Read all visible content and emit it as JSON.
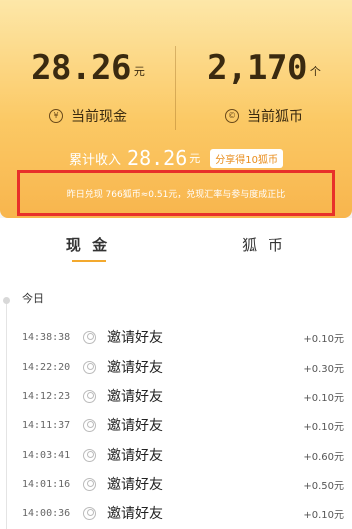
{
  "summary": {
    "cash_value": "28.26",
    "cash_unit": "元",
    "cash_label": "当前现金",
    "cash_icon_glyph": "¥",
    "coins_value": "2,170",
    "coins_unit": "个",
    "coins_label": "当前狐币",
    "coins_icon_glyph": "©",
    "total_label": "累计收入",
    "total_value": "28.26",
    "total_unit": "元",
    "share_button": "分享得10狐币",
    "notice": "昨日兑现 766狐币≈0.51元，兑现汇率与参与度成正比"
  },
  "tabs": [
    {
      "label": "现 金",
      "active": true
    },
    {
      "label": "狐 币",
      "active": false
    }
  ],
  "list": {
    "day_label": "今日",
    "rows": [
      {
        "time": "14:38:38",
        "title": "邀请好友",
        "amount": "+0.10元"
      },
      {
        "time": "14:22:20",
        "title": "邀请好友",
        "amount": "+0.30元"
      },
      {
        "time": "14:12:23",
        "title": "邀请好友",
        "amount": "+0.10元"
      },
      {
        "time": "14:11:37",
        "title": "邀请好友",
        "amount": "+0.10元"
      },
      {
        "time": "14:03:41",
        "title": "邀请好友",
        "amount": "+0.60元"
      },
      {
        "time": "14:01:16",
        "title": "邀请好友",
        "amount": "+0.50元"
      },
      {
        "time": "14:00:36",
        "title": "邀请好友",
        "amount": "+0.10元"
      }
    ]
  },
  "colors": {
    "accent": "#f3a92e",
    "highlight_border": "#e8302a"
  }
}
